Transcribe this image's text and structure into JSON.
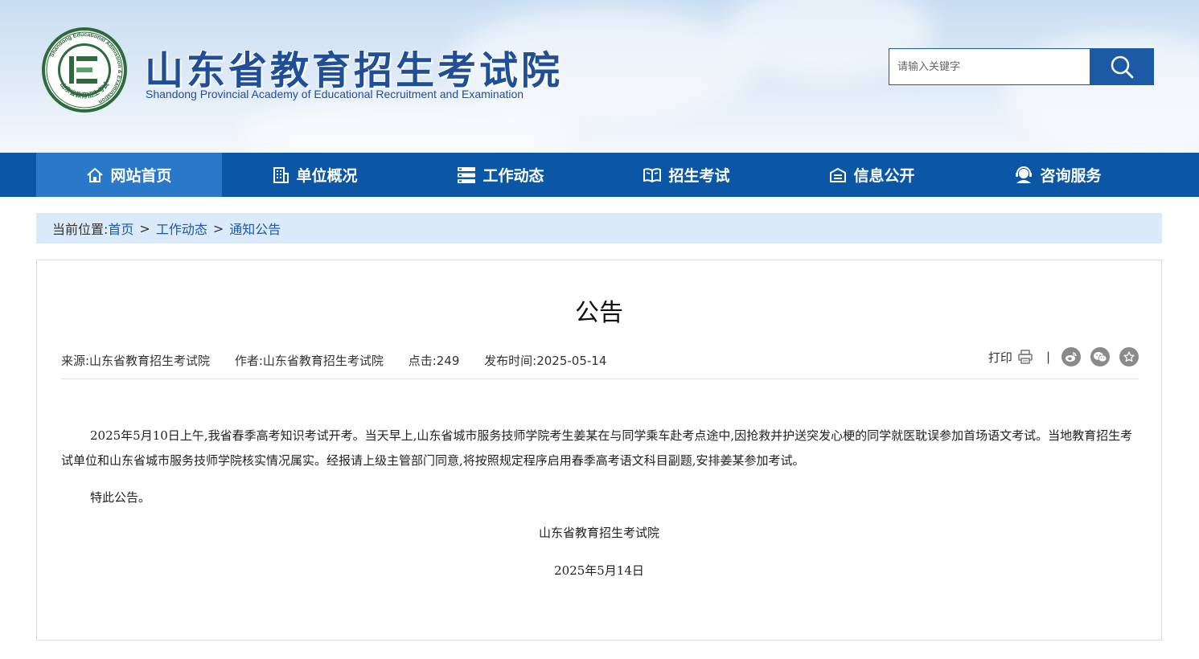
{
  "header": {
    "title_cn": "山东省教育招生考试院",
    "title_en": "Shandong Provincial Academy of Educational Recruitment and Examination",
    "logo_ring_text": "Shandong Educational Admission & Examination",
    "logo_bottom_text": "山东省教育招生考试",
    "logo_letter": "E"
  },
  "search": {
    "placeholder": "请输入关键字",
    "value": ""
  },
  "nav": {
    "items": [
      {
        "label": "网站首页",
        "icon": "home-icon",
        "active": true
      },
      {
        "label": "单位概况",
        "icon": "building-icon",
        "active": false
      },
      {
        "label": "工作动态",
        "icon": "list-icon",
        "active": false
      },
      {
        "label": "招生考试",
        "icon": "book-icon",
        "active": false
      },
      {
        "label": "信息公开",
        "icon": "info-icon",
        "active": false
      },
      {
        "label": "咨询服务",
        "icon": "support-icon",
        "active": false
      }
    ]
  },
  "breadcrumb": {
    "prefix": "当前位置:",
    "items": [
      "首页",
      "工作动态",
      "通知公告"
    ],
    "separator": ">"
  },
  "article": {
    "title": "公告",
    "source": "来源:山东省教育招生考试院",
    "author": "作者:山东省教育招生考试院",
    "clicks": "点击:249",
    "date": "发布时间:2025-05-14",
    "print_label": "打印",
    "divider": "|",
    "paragraph1": "2025年5月10日上午,我省春季高考知识考试开考。当天早上,山东省城市服务技师学院考生姜某在与同学乘车赴考点途中,因抢救并护送突发心梗的同学就医耽误参加首场语文考试。当地教育招生考试单位和山东省城市服务技师学院核实情况属实。经报请上级主管部门同意,将按照规定程序启用春季高考语文科目副题,安排姜某参加考试。",
    "paragraph2": "特此公告。",
    "signature": "山东省教育招生考试院",
    "sign_date": "2025年5月14日"
  },
  "colors": {
    "primary": "#0c57a5",
    "nav_active": "#2a78c9",
    "breadcrumb_bg": "#dbeafa",
    "title_blue": "#1f4f96",
    "logo_green": "#2e6b3c"
  }
}
